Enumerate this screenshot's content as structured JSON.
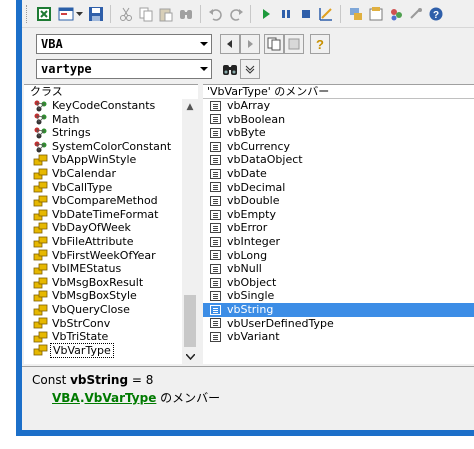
{
  "toolbar": {
    "buttons": [
      "excel-icon",
      "form-icon",
      "save-icon",
      "cut-icon",
      "copy-icon",
      "paste-icon",
      "find-icon",
      "undo-icon",
      "redo-icon",
      "run-icon",
      "pause-icon",
      "stop-icon",
      "design-mode-icon",
      "project-explorer-icon",
      "properties-icon",
      "toolbox-icon",
      "help-icon"
    ]
  },
  "library_combo": {
    "value": "VBA"
  },
  "search_combo": {
    "value": "vartype"
  },
  "classes_pane": {
    "header": "クラス",
    "items": [
      {
        "label": "KeyCodeConstants",
        "icon": "module-icon"
      },
      {
        "label": "Math",
        "icon": "module-icon"
      },
      {
        "label": "Strings",
        "icon": "module-icon"
      },
      {
        "label": "SystemColorConstant",
        "icon": "module-icon"
      },
      {
        "label": "VbAppWinStyle",
        "icon": "enum-icon"
      },
      {
        "label": "VbCalendar",
        "icon": "enum-icon"
      },
      {
        "label": "VbCallType",
        "icon": "enum-icon"
      },
      {
        "label": "VbCompareMethod",
        "icon": "enum-icon"
      },
      {
        "label": "VbDateTimeFormat",
        "icon": "enum-icon"
      },
      {
        "label": "VbDayOfWeek",
        "icon": "enum-icon"
      },
      {
        "label": "VbFileAttribute",
        "icon": "enum-icon"
      },
      {
        "label": "VbFirstWeekOfYear",
        "icon": "enum-icon"
      },
      {
        "label": "VbIMEStatus",
        "icon": "enum-icon"
      },
      {
        "label": "VbMsgBoxResult",
        "icon": "enum-icon"
      },
      {
        "label": "VbMsgBoxStyle",
        "icon": "enum-icon"
      },
      {
        "label": "VbQueryClose",
        "icon": "enum-icon"
      },
      {
        "label": "VbStrConv",
        "icon": "enum-icon"
      },
      {
        "label": "VbTriState",
        "icon": "enum-icon"
      },
      {
        "label": "VbVarType",
        "icon": "enum-icon"
      }
    ],
    "selected_index": 18
  },
  "members_pane": {
    "header": "'VbVarType' のメンバー",
    "items": [
      "vbArray",
      "vbBoolean",
      "vbByte",
      "vbCurrency",
      "vbDataObject",
      "vbDate",
      "vbDecimal",
      "vbDouble",
      "vbEmpty",
      "vbError",
      "vbInteger",
      "vbLong",
      "vbNull",
      "vbObject",
      "vbSingle",
      "vbString",
      "vbUserDefinedType",
      "vbVariant"
    ],
    "selected_index": 15
  },
  "details": {
    "prefix": "Const ",
    "name": "vbString",
    "value": " = 8",
    "library_link": "VBA",
    "dot": ".",
    "class_link": "VbVarType",
    "suffix": " のメンバー"
  },
  "colors": {
    "selection": "#3c8de6",
    "frame": "#1c6fc9",
    "link": "#007a00"
  }
}
